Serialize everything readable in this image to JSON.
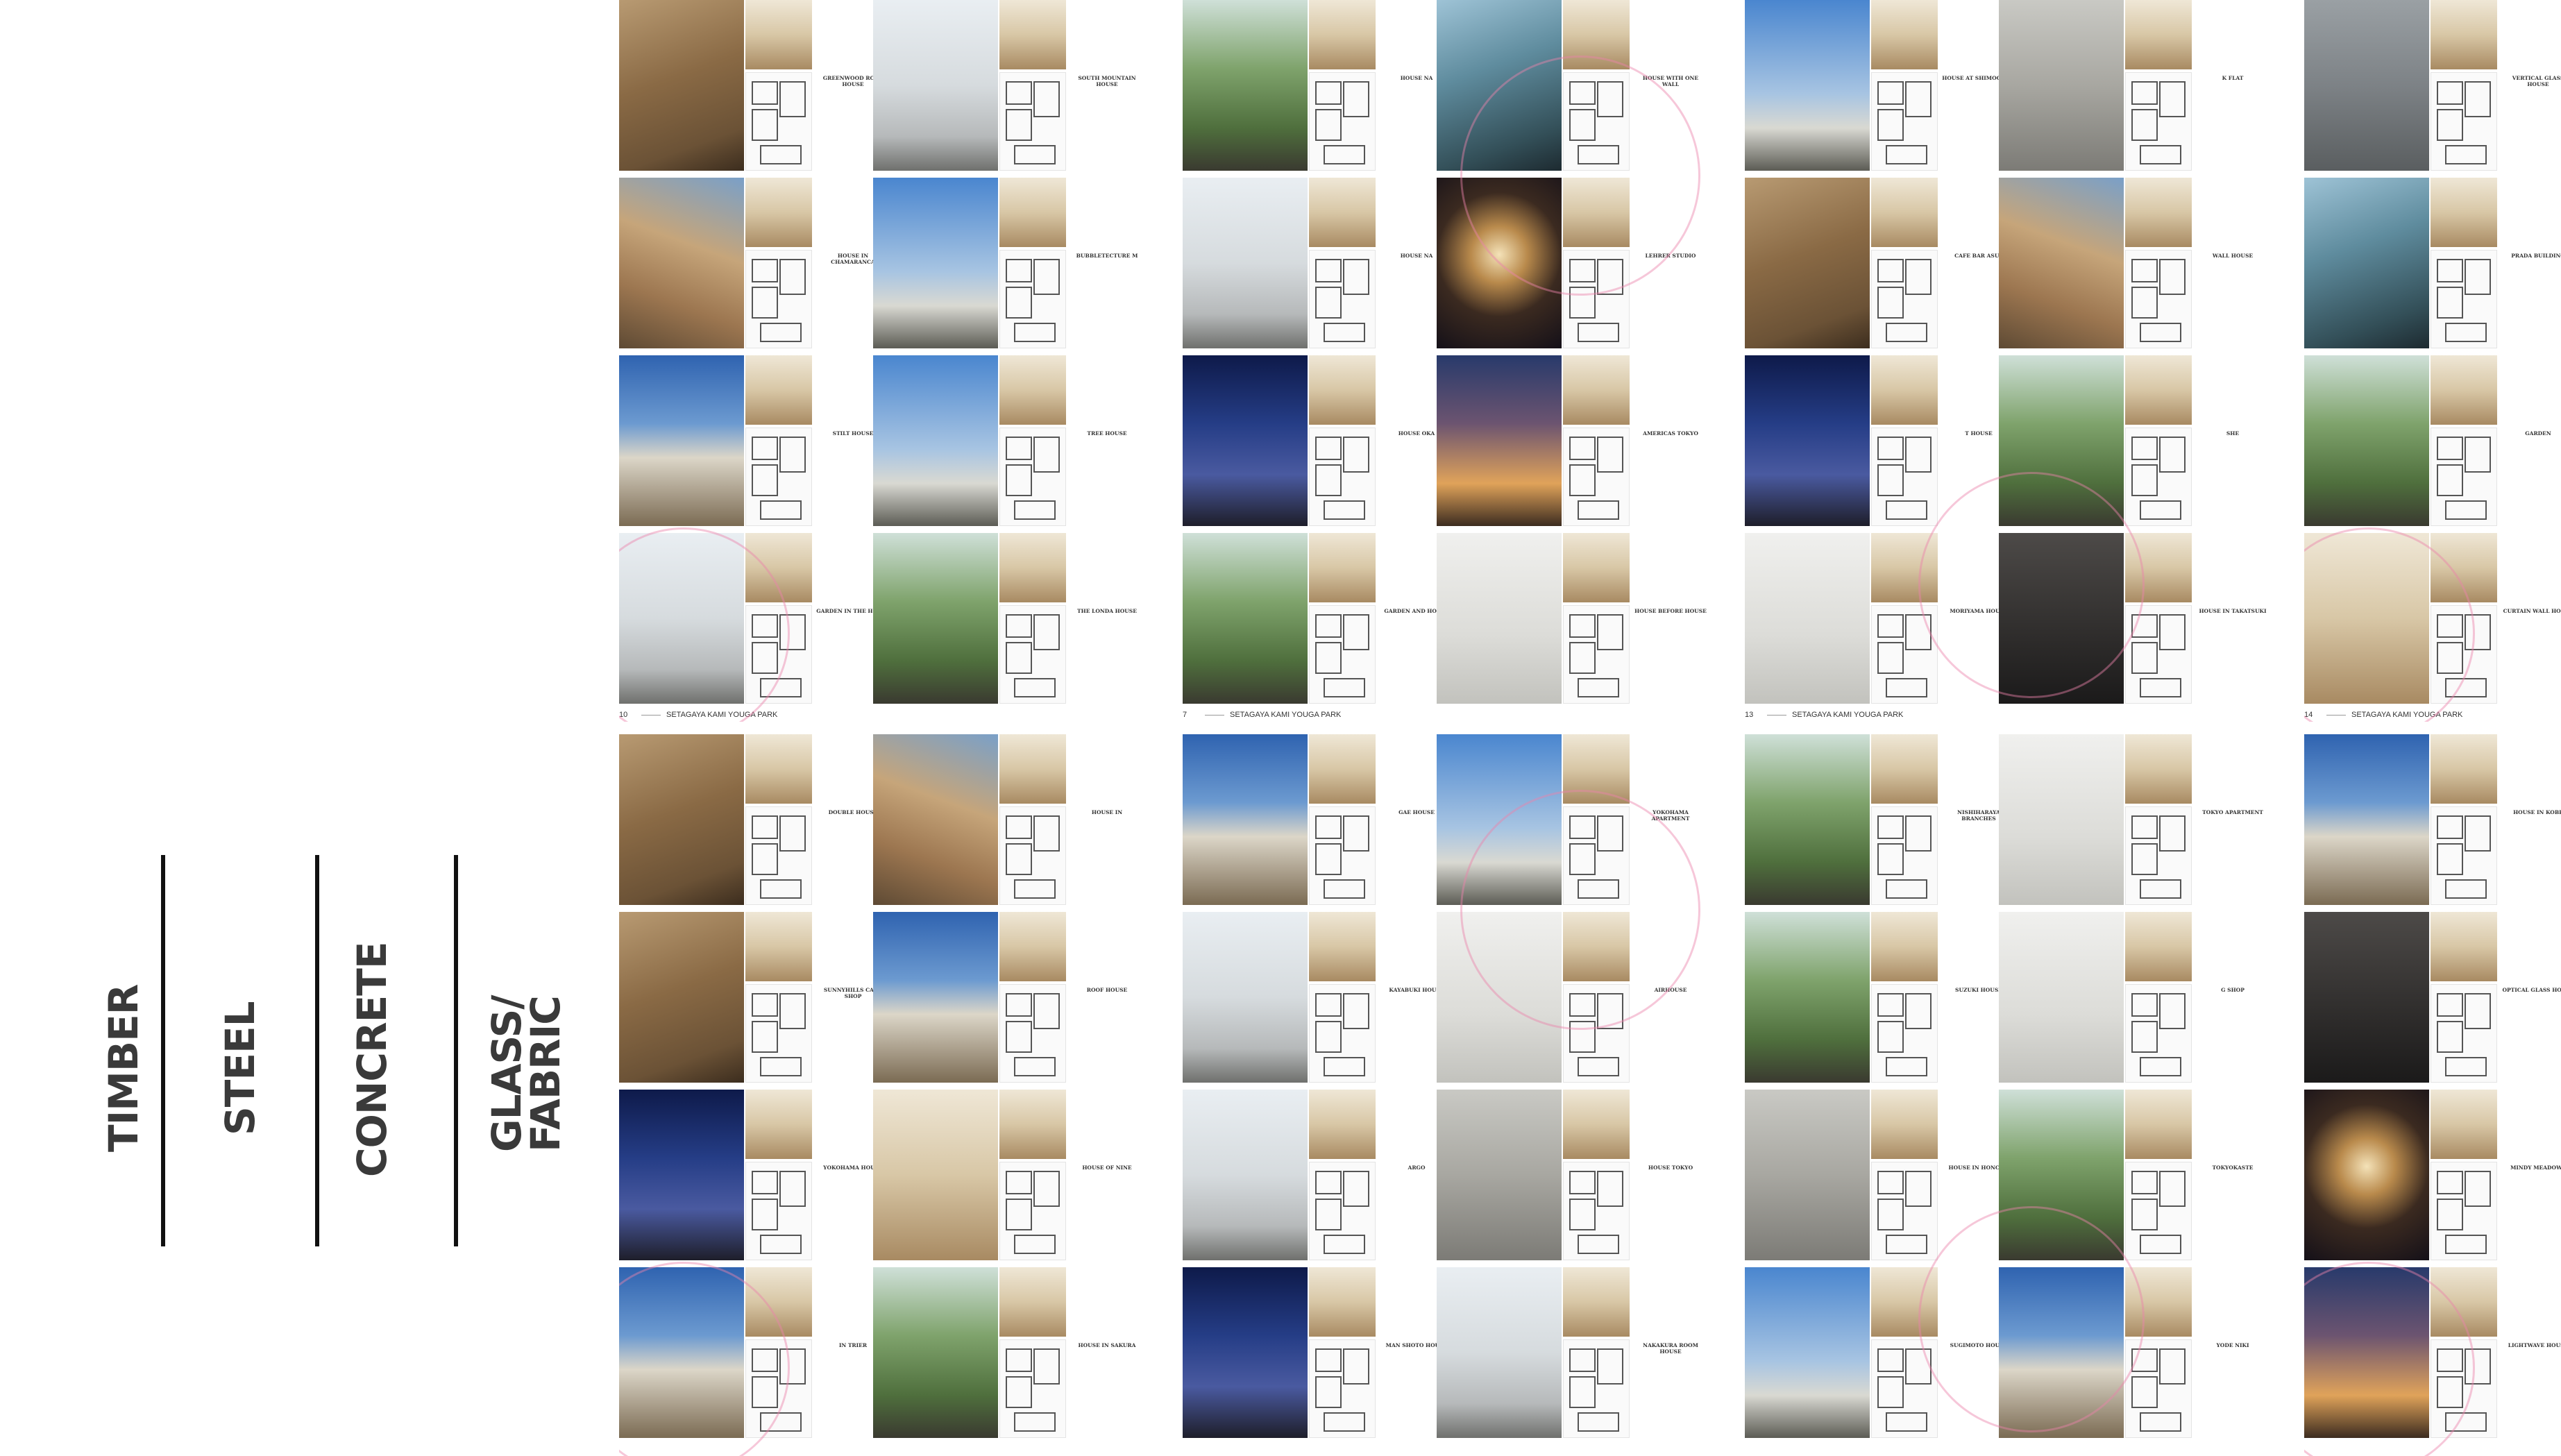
{
  "categories": [
    {
      "label": "TIMBER"
    },
    {
      "label": "STEEL"
    },
    {
      "label": "CONCRETE"
    },
    {
      "label": "GLASS/\nFABRIC"
    }
  ],
  "spreads_top": [
    {
      "footer": {
        "page": "10",
        "title": "SETAGAYA KAMI YOUGA PARK"
      },
      "left": [
        {
          "name": "GREENWOOD ROAD HOUSE",
          "palette": "p-wood"
        },
        {
          "name": "HOUSE IN CHAMARANCA",
          "palette": "p-wood2"
        },
        {
          "name": "STILT HOUSE",
          "palette": "p-sky"
        },
        {
          "name": "GARDEN IN THE HOUSE",
          "palette": "p-white"
        }
      ],
      "right": [
        {
          "name": "SOUTH MOUNTAIN HOUSE",
          "palette": "p-white"
        },
        {
          "name": "BUBBLETECTURE M",
          "palette": "p-sky2"
        },
        {
          "name": "TREE HOUSE",
          "palette": "p-sky2"
        },
        {
          "name": "THE LONDA HOUSE",
          "palette": "p-green"
        }
      ]
    },
    {
      "footer": {
        "page": "7",
        "title": "SETAGAYA KAMI YOUGA PARK"
      },
      "left": [
        {
          "name": "HOUSE NA",
          "palette": "p-green"
        },
        {
          "name": "HOUSE NA",
          "palette": "p-white"
        },
        {
          "name": "HOUSE OKA",
          "palette": "p-night"
        },
        {
          "name": "GARDEN AND HOUSE",
          "palette": "p-green"
        }
      ],
      "right": [
        {
          "name": "HOUSE WITH ONE WALL",
          "palette": "p-glass"
        },
        {
          "name": "LEHRER STUDIO",
          "palette": "p-night2"
        },
        {
          "name": "AMERICAS TOKYO",
          "palette": "p-warm"
        },
        {
          "name": "HOUSE BEFORE HOUSE",
          "palette": "p-lightgrey"
        }
      ]
    },
    {
      "footer": {
        "page": "13",
        "title": "SETAGAYA KAMI YOUGA PARK"
      },
      "left": [
        {
          "name": "HOUSE AT SHIMOGAMO",
          "palette": "p-sky2"
        },
        {
          "name": "CAFE BAR ASUS",
          "palette": "p-wood"
        },
        {
          "name": "T HOUSE",
          "palette": "p-night"
        },
        {
          "name": "MORIYAMA HOUSE",
          "palette": "p-lightgrey"
        }
      ],
      "right": [
        {
          "name": "K FLAT",
          "palette": "p-concrete"
        },
        {
          "name": "WALL HOUSE",
          "palette": "p-wood2"
        },
        {
          "name": "SHE",
          "palette": "p-green"
        },
        {
          "name": "HOUSE IN TAKATSUKI",
          "palette": "p-dark"
        }
      ]
    },
    {
      "footer": {
        "page": "14",
        "title": "SETAGAYA KAMI YOUGA PARK"
      },
      "left": [
        {
          "name": "VERTICAL GLASS HOUSE",
          "palette": "p-grey"
        },
        {
          "name": "PRADA BUILDING",
          "palette": "p-glass"
        },
        {
          "name": "GARDEN",
          "palette": "p-green"
        },
        {
          "name": "CURTAIN WALL HOUSE",
          "palette": "p-interior"
        }
      ],
      "right": []
    }
  ],
  "spreads_bottom": [
    {
      "left": [
        {
          "name": "DOUBLE HOUSE",
          "palette": "p-wood"
        },
        {
          "name": "SUNNYHILLS CAKE SHOP",
          "palette": "p-wood"
        },
        {
          "name": "YOKOHAMA HOUSE",
          "palette": "p-night"
        },
        {
          "name": "IN TRIER",
          "palette": "p-sky"
        }
      ],
      "right": [
        {
          "name": "HOUSE IN",
          "palette": "p-wood2"
        },
        {
          "name": "ROOF HOUSE",
          "palette": "p-sky"
        },
        {
          "name": "HOUSE OF NINE",
          "palette": "p-interior"
        },
        {
          "name": "HOUSE IN SAKURA",
          "palette": "p-green"
        }
      ]
    },
    {
      "left": [
        {
          "name": "GAE HOUSE",
          "palette": "p-sky"
        },
        {
          "name": "KAYABUKI HOUSE",
          "palette": "p-white"
        },
        {
          "name": "ARGO",
          "palette": "p-white"
        },
        {
          "name": "MAN SHOTO HOUSE",
          "palette": "p-night"
        }
      ],
      "right": [
        {
          "name": "YOKOHAMA APARTMENT",
          "palette": "p-sky2"
        },
        {
          "name": "AIRHOUSE",
          "palette": "p-lightgrey"
        },
        {
          "name": "HOUSE TOKYO",
          "palette": "p-concrete"
        },
        {
          "name": "NAKAKURA ROOM HOUSE",
          "palette": "p-white"
        }
      ]
    },
    {
      "left": [
        {
          "name": "NISHIHARAYA BRANCHES",
          "palette": "p-green"
        },
        {
          "name": "SUZUKI HOUSE",
          "palette": "p-green"
        },
        {
          "name": "HOUSE IN HONCHO",
          "palette": "p-concrete"
        },
        {
          "name": "SUGIMOTO HOUSE",
          "palette": "p-sky2"
        }
      ],
      "right": [
        {
          "name": "TOKYO APARTMENT",
          "palette": "p-lightgrey"
        },
        {
          "name": "G SHOP",
          "palette": "p-lightgrey"
        },
        {
          "name": "TOKYOKASTE",
          "palette": "p-green"
        },
        {
          "name": "YODE NIKI",
          "palette": "p-sky"
        }
      ]
    },
    {
      "left": [
        {
          "name": "HOUSE IN KOBE",
          "palette": "p-sky"
        },
        {
          "name": "OPTICAL GLASS HOUSE",
          "palette": "p-dark"
        },
        {
          "name": "MINDY MEADOWS",
          "palette": "p-night2"
        },
        {
          "name": "LIGHTWAVE HOUSE",
          "palette": "p-warm"
        }
      ],
      "right": []
    }
  ]
}
